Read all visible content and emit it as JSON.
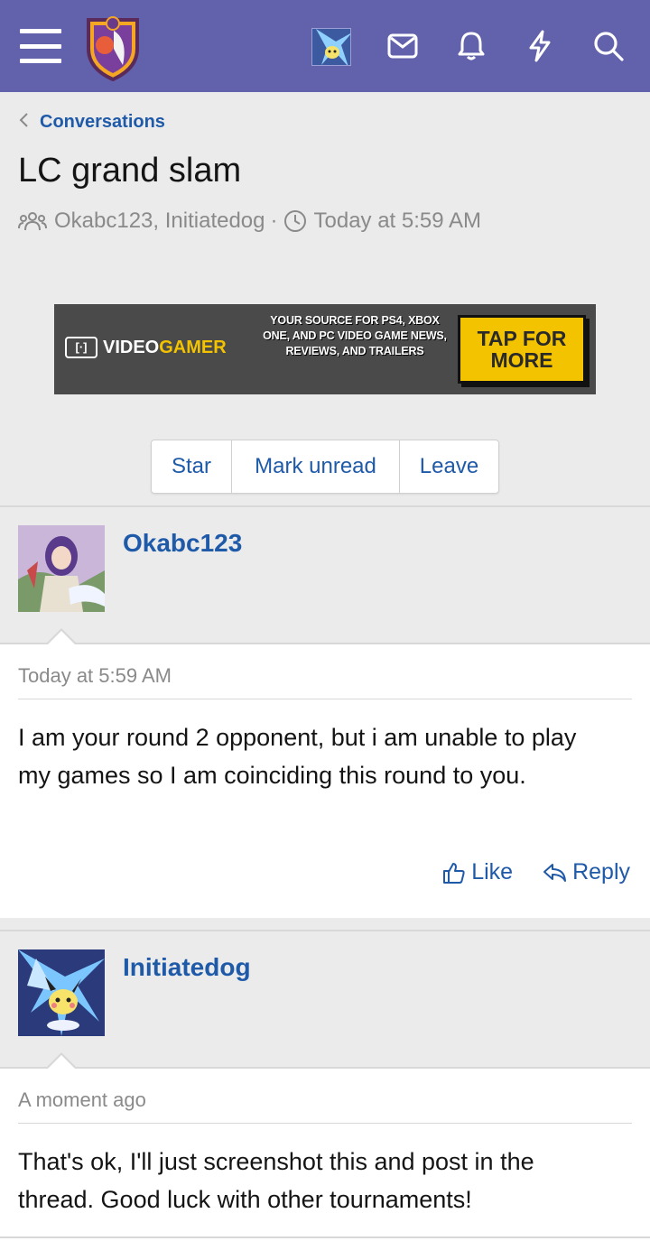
{
  "header": {
    "brand_color": "#6161ac",
    "menu_icon": "hamburger-icon",
    "logo_icon": "shield-logo-icon",
    "icons": [
      "mail-icon",
      "bell-icon",
      "lightning-icon",
      "search-icon"
    ]
  },
  "breadcrumb": {
    "label": "Conversations"
  },
  "conversation": {
    "title": "LC grand slam",
    "participants": "Okabc123, Initiatedog",
    "separator": "·",
    "time": "Today at 5:59 AM"
  },
  "ad": {
    "brand_a": "VIDEO",
    "brand_b": "GAMER",
    "copy": "YOUR SOURCE FOR PS4, XBOX ONE, AND PC VIDEO GAME NEWS, REVIEWS, AND TRAILERS",
    "cta": "TAP FOR MORE"
  },
  "buttons": {
    "star": "Star",
    "mark_unread": "Mark unread",
    "leave": "Leave"
  },
  "messages": [
    {
      "author": "Okabc123",
      "date": "Today at 5:59 AM",
      "body": "I am your round 2 opponent, but i am unable to play my games so I am coinciding this round to you.",
      "like": "Like",
      "reply": "Reply"
    },
    {
      "author": "Initiatedog",
      "date": "A moment ago",
      "body": "That's ok, I'll just screenshot this and post in the thread. Good luck with other tournaments!"
    }
  ]
}
